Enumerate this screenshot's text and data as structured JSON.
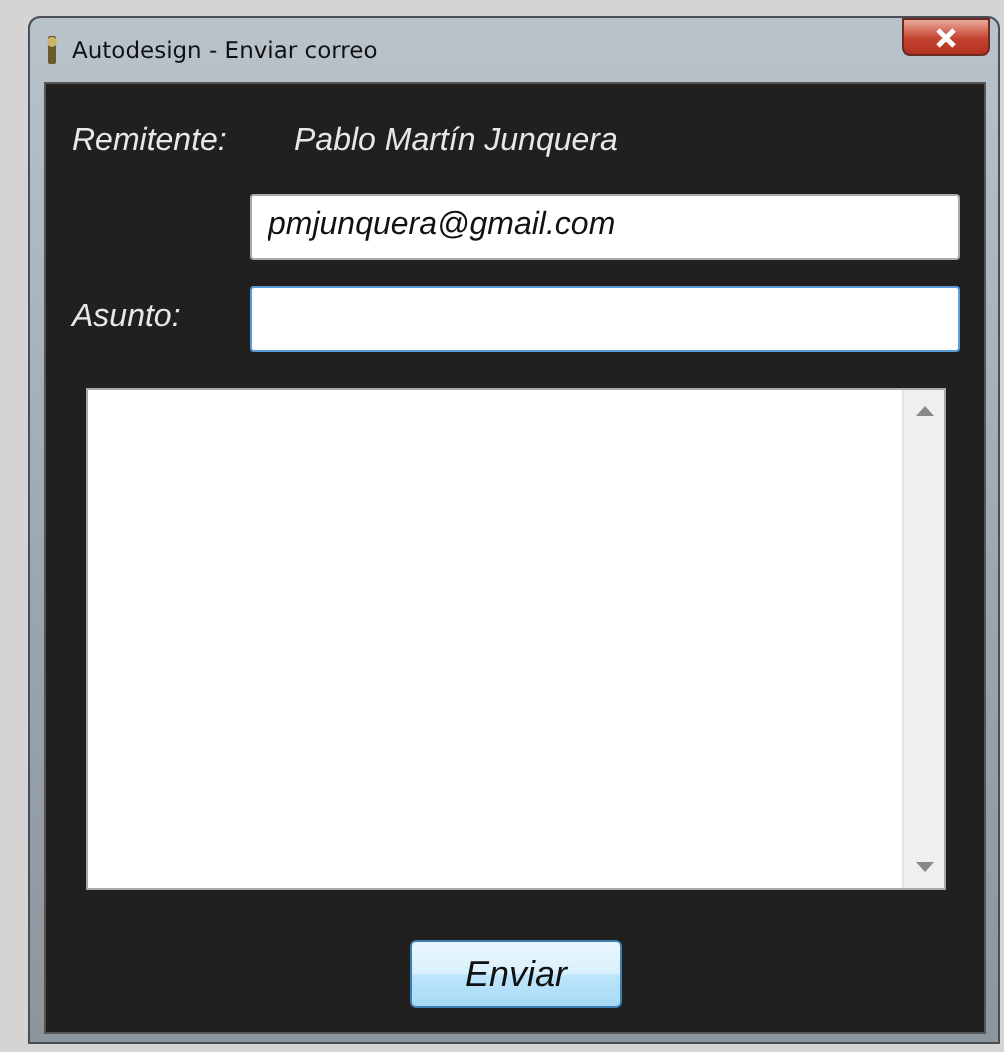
{
  "window": {
    "title": "Autodesign - Enviar correo"
  },
  "sender": {
    "label": "Remitente:",
    "name": "Pablo Martín Junquera",
    "email": "pmjunquera@gmail.com"
  },
  "subject": {
    "label": "Asunto:"
  },
  "buttons": [
    "Enviar"
  ]
}
